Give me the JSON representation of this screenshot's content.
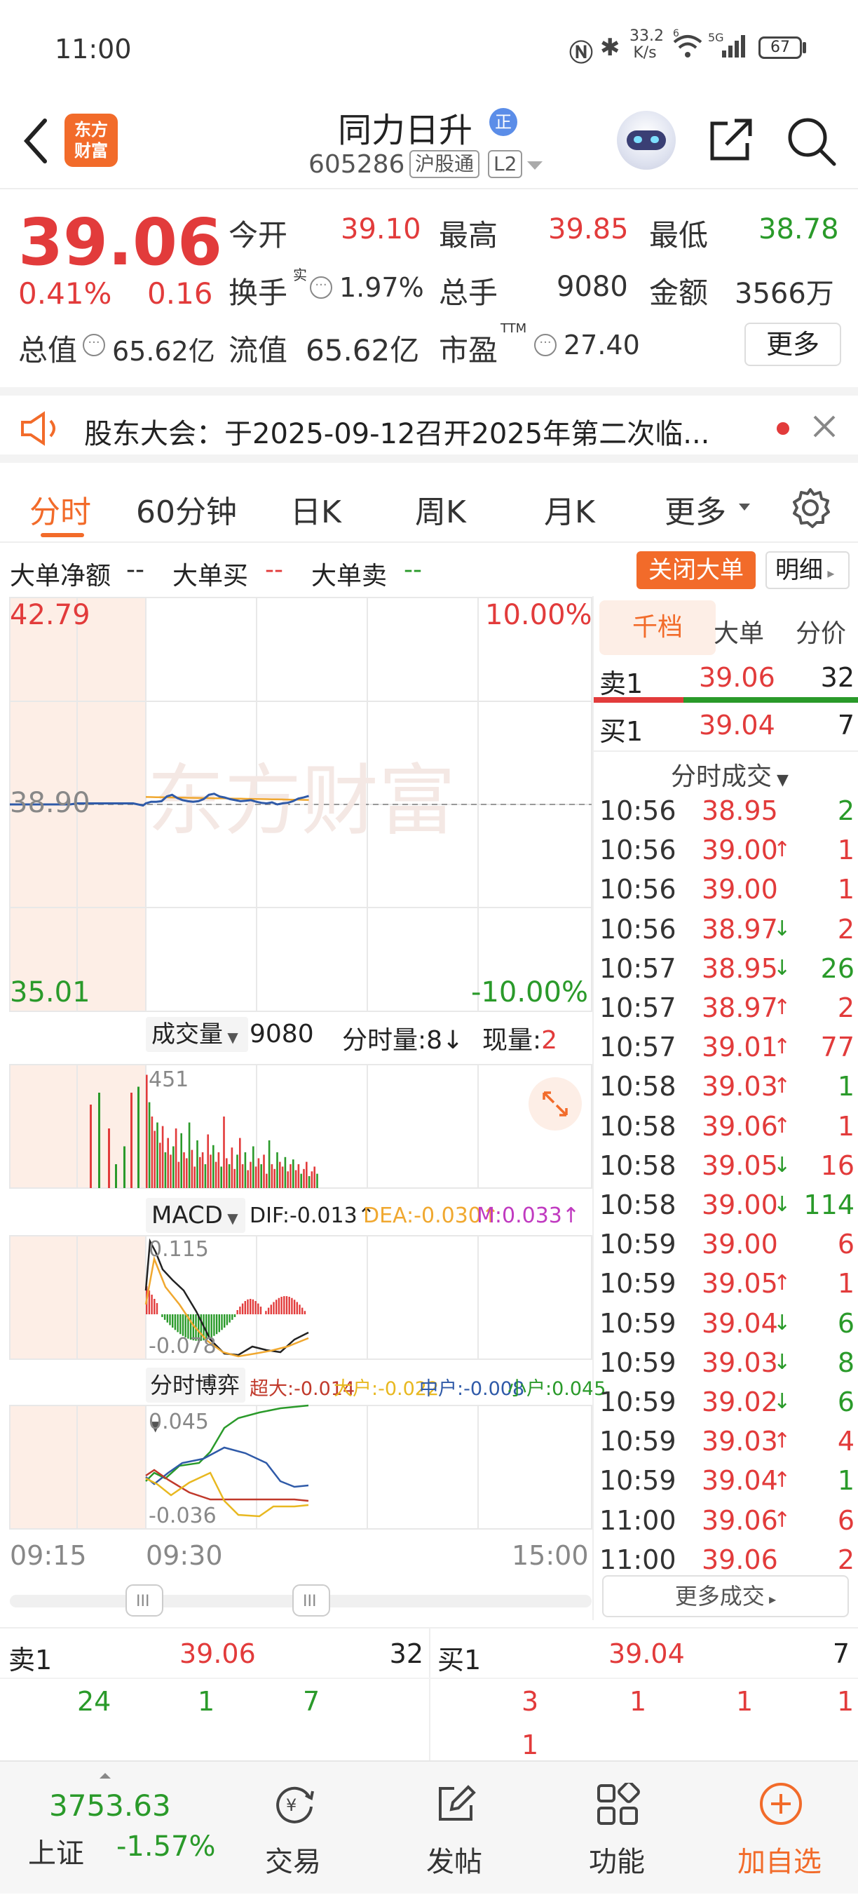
{
  "status": {
    "time": "11:00",
    "net_speed": "33.2",
    "net_unit": "K/s",
    "battery": "67",
    "signal_5g": "5G",
    "wifi_6": "6"
  },
  "header": {
    "logo_line1": "东方",
    "logo_line2": "财富",
    "stock_name": "同力日升",
    "badge": "正",
    "code": "605286",
    "exchange_tag": "沪股通",
    "level_tag": "L2"
  },
  "quote": {
    "price": "39.06",
    "pct": "0.41%",
    "change": "0.16",
    "open_label": "今开",
    "open": "39.10",
    "high_label": "最高",
    "high": "39.85",
    "low_label": "最低",
    "low": "38.78",
    "turnover_label": "换手",
    "turnover_sup": "实",
    "turnover": "1.97%",
    "volume_label": "总手",
    "volume": "9080",
    "amount_label": "金额",
    "amount": "3566万",
    "mktcap_label": "总值",
    "mktcap": "65.62亿",
    "float_label": "流值",
    "float": "65.62亿",
    "pe_label": "市盈",
    "pe_sup": "TTM",
    "pe": "27.40",
    "more": "更多"
  },
  "notice": {
    "text": "股东大会：于2025-09-12召开2025年第二次临..."
  },
  "tabs": {
    "t1": "分时",
    "t2": "60分钟",
    "t3": "日K",
    "t4": "周K",
    "t5": "月K",
    "more": "更多"
  },
  "bigorder": {
    "net_label": "大单净额",
    "net_val": "--",
    "buy_label": "大单买",
    "buy_val": "--",
    "sell_label": "大单卖",
    "sell_val": "--",
    "close_btn": "关闭大单",
    "detail_btn": "明细"
  },
  "chart": {
    "top_price": "42.79",
    "top_pct": "10.00%",
    "mid_price": "38.90",
    "bottom_price": "35.01",
    "bottom_pct": "-10.00%",
    "vol_label": "成交量",
    "vol_total": "9080",
    "vol_min_label": "分时量:8",
    "vol_now_label": "现量:",
    "vol_now": "2",
    "vol_max": "451",
    "macd_label": "MACD",
    "macd_dif": "DIF:-0.013",
    "macd_dea": "DEA:-0.030",
    "macd_m": "M:0.033",
    "macd_top": "0.115",
    "macd_bottom": "-0.078",
    "game_label": "分时博弈",
    "game_super": "超大:-0.014",
    "game_large": "大户:-0.022",
    "game_mid": "中户:-0.008",
    "game_small": "小户:0.045",
    "game_top": "0.045",
    "game_bottom": "-0.036",
    "t_start": "09:15",
    "t_open": "09:30",
    "t_end": "15:00",
    "colors": {
      "price_line": "#2f5aa8",
      "avg_line": "#f0a830",
      "up": "#e23b3b",
      "down": "#2a9a2a",
      "pre_bg": "#fdeee6"
    }
  },
  "side": {
    "tabs": [
      "千档",
      "大单",
      "分价"
    ],
    "sell1_label": "卖1",
    "sell1_price": "39.06",
    "sell1_vol": "32",
    "buy1_label": "买1",
    "buy1_price": "39.04",
    "buy1_vol": "7",
    "trades_title": "分时成交",
    "trades": [
      {
        "t": "10:56",
        "p": "38.95",
        "a": "",
        "v": "2",
        "c": "green"
      },
      {
        "t": "10:56",
        "p": "39.00",
        "a": "↑",
        "v": "1",
        "c": "red"
      },
      {
        "t": "10:56",
        "p": "39.00",
        "a": "",
        "v": "1",
        "c": "red"
      },
      {
        "t": "10:56",
        "p": "38.97",
        "a": "↓",
        "v": "2",
        "c": "red"
      },
      {
        "t": "10:57",
        "p": "38.95",
        "a": "↓",
        "v": "26",
        "c": "green"
      },
      {
        "t": "10:57",
        "p": "38.97",
        "a": "↑",
        "v": "2",
        "c": "red"
      },
      {
        "t": "10:57",
        "p": "39.01",
        "a": "↑",
        "v": "77",
        "c": "red"
      },
      {
        "t": "10:58",
        "p": "39.03",
        "a": "↑",
        "v": "1",
        "c": "green"
      },
      {
        "t": "10:58",
        "p": "39.06",
        "a": "↑",
        "v": "1",
        "c": "red"
      },
      {
        "t": "10:58",
        "p": "39.05",
        "a": "↓",
        "v": "16",
        "c": "red"
      },
      {
        "t": "10:58",
        "p": "39.00",
        "a": "↓",
        "v": "114",
        "c": "green"
      },
      {
        "t": "10:59",
        "p": "39.00",
        "a": "",
        "v": "6",
        "c": "red"
      },
      {
        "t": "10:59",
        "p": "39.05",
        "a": "↑",
        "v": "1",
        "c": "red"
      },
      {
        "t": "10:59",
        "p": "39.04",
        "a": "↓",
        "v": "6",
        "c": "green"
      },
      {
        "t": "10:59",
        "p": "39.03",
        "a": "↓",
        "v": "8",
        "c": "green"
      },
      {
        "t": "10:59",
        "p": "39.02",
        "a": "↓",
        "v": "6",
        "c": "green"
      },
      {
        "t": "10:59",
        "p": "39.03",
        "a": "↑",
        "v": "4",
        "c": "red"
      },
      {
        "t": "10:59",
        "p": "39.04",
        "a": "↑",
        "v": "1",
        "c": "green"
      },
      {
        "t": "11:00",
        "p": "39.06",
        "a": "↑",
        "v": "6",
        "c": "red"
      },
      {
        "t": "11:00",
        "p": "39.06",
        "a": "",
        "v": "2",
        "c": "red"
      }
    ],
    "more_trades": "更多成交"
  },
  "book": {
    "sell_label": "卖1",
    "sell_price": "39.06",
    "sell_vol": "32",
    "sell_q1": "24",
    "sell_q2": "1",
    "sell_q3": "7",
    "buy_label": "买1",
    "buy_price": "39.04",
    "buy_vol": "7",
    "buy_q1": "3",
    "buy_q2": "1",
    "buy_q3": "1",
    "buy_q4": "1",
    "buy_q5": "1"
  },
  "bottomnav": {
    "index_value": "3753.63",
    "index_name": "上证",
    "index_pct": "-1.57%",
    "trade": "交易",
    "post": "发帖",
    "func": "功能",
    "add": "加自选"
  }
}
